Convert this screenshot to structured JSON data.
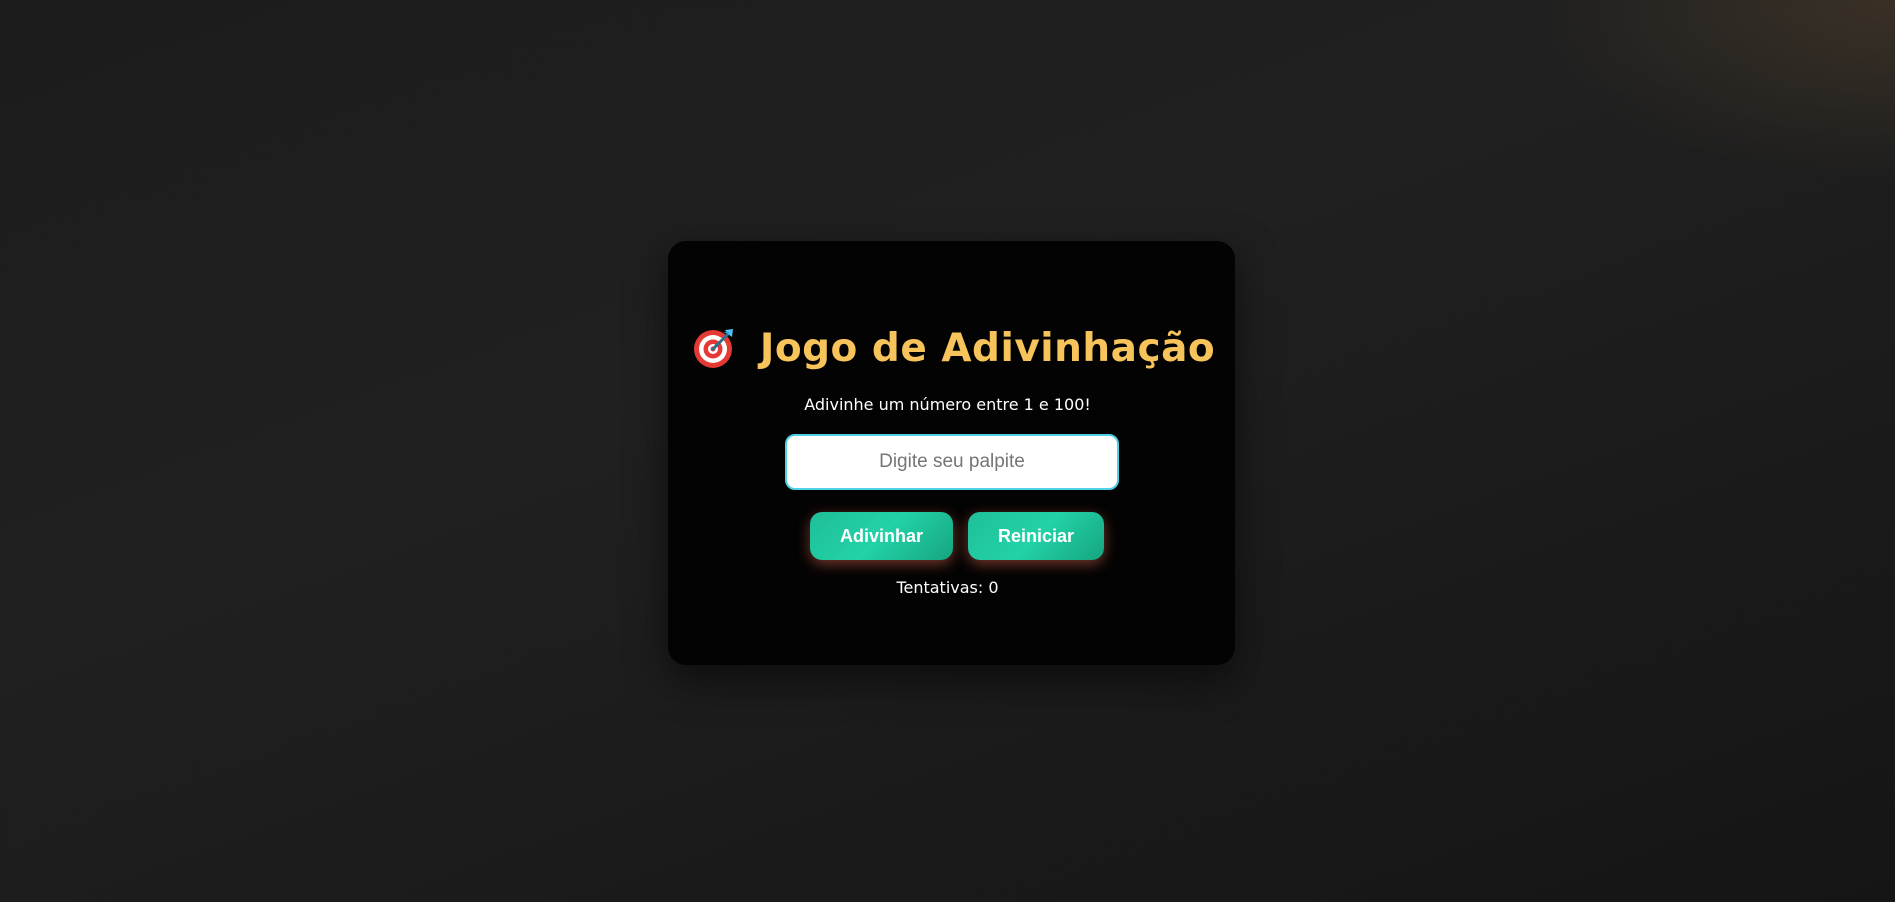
{
  "game": {
    "title": "Jogo de Adivinhação",
    "title_icon": "target-dart-icon",
    "subtitle": "Adivinhe um número entre 1 e 100!",
    "input": {
      "placeholder": "Digite seu palpite",
      "value": ""
    },
    "buttons": {
      "guess_label": "Adivinhar",
      "reset_label": "Reiniciar"
    },
    "attempts": {
      "label": "Tentativas:",
      "value": "0"
    }
  },
  "colors": {
    "title": "#f7c35b",
    "button": "#1fbf98",
    "input_border": "#4fd1e6",
    "card": "#030303",
    "background": "#1c1c1c"
  }
}
